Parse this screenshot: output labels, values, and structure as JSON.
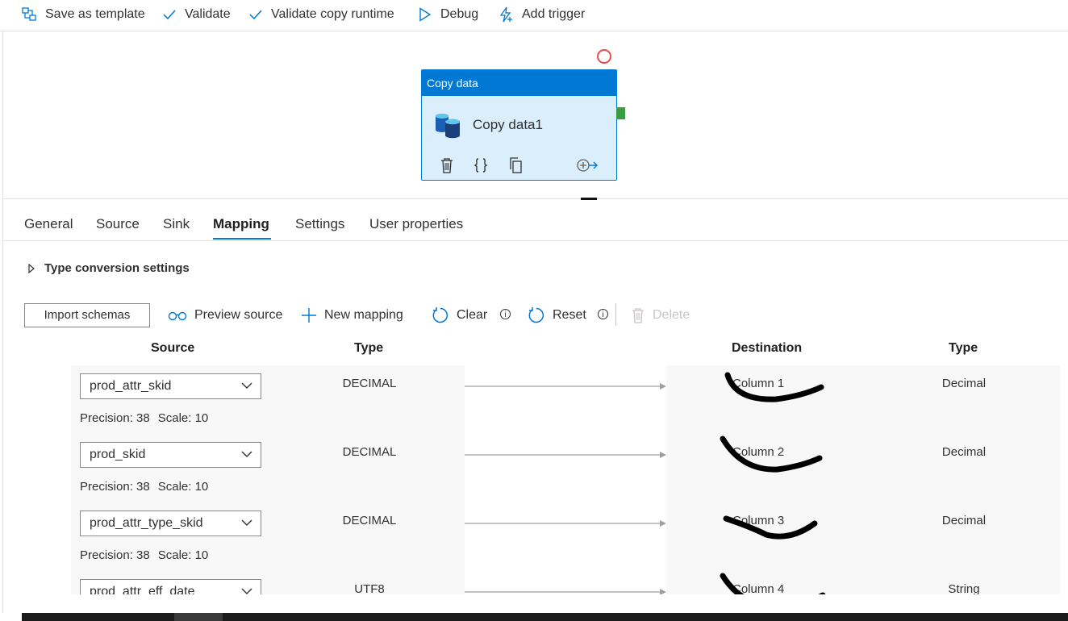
{
  "toolbar": {
    "save_template": "Save as template",
    "validate": "Validate",
    "validate_copy_runtime": "Validate copy runtime",
    "debug": "Debug",
    "add_trigger": "Add trigger"
  },
  "activity": {
    "type_label": "Copy data",
    "name": "Copy data1"
  },
  "tabs": [
    "General",
    "Source",
    "Sink",
    "Mapping",
    "Settings",
    "User properties"
  ],
  "active_tab": "Mapping",
  "type_conversion_label": "Type conversion settings",
  "mapping_toolbar": {
    "import_schemas": "Import schemas",
    "preview_source": "Preview source",
    "new_mapping": "New mapping",
    "clear": "Clear",
    "reset": "Reset",
    "delete": "Delete",
    "info_glyph": "i"
  },
  "columns": {
    "source": "Source",
    "source_type": "Type",
    "destination": "Destination",
    "destination_type": "Type"
  },
  "precision_label": "Precision: 38",
  "scale_label": "Scale: 10",
  "rows": [
    {
      "source": "prod_attr_skid",
      "source_type": "DECIMAL",
      "precision": "Precision: 38",
      "scale": "Scale: 10",
      "destination": "Column 1",
      "destination_type": "Decimal"
    },
    {
      "source": "prod_skid",
      "source_type": "DECIMAL",
      "precision": "Precision: 38",
      "scale": "Scale: 10",
      "destination": "Column 2",
      "destination_type": "Decimal"
    },
    {
      "source": "prod_attr_type_skid",
      "source_type": "DECIMAL",
      "precision": "Precision: 38",
      "scale": "Scale: 10",
      "destination": "Column 3",
      "destination_type": "Decimal"
    },
    {
      "source": "prod_attr_eff_date",
      "source_type": "UTF8",
      "destination": "Column 4",
      "destination_type": "String"
    }
  ],
  "colors": {
    "accent": "#0078d4",
    "activity_bg": "#daeefb",
    "port_green": "#3b9c43",
    "marker_red": "#e84b4b"
  }
}
